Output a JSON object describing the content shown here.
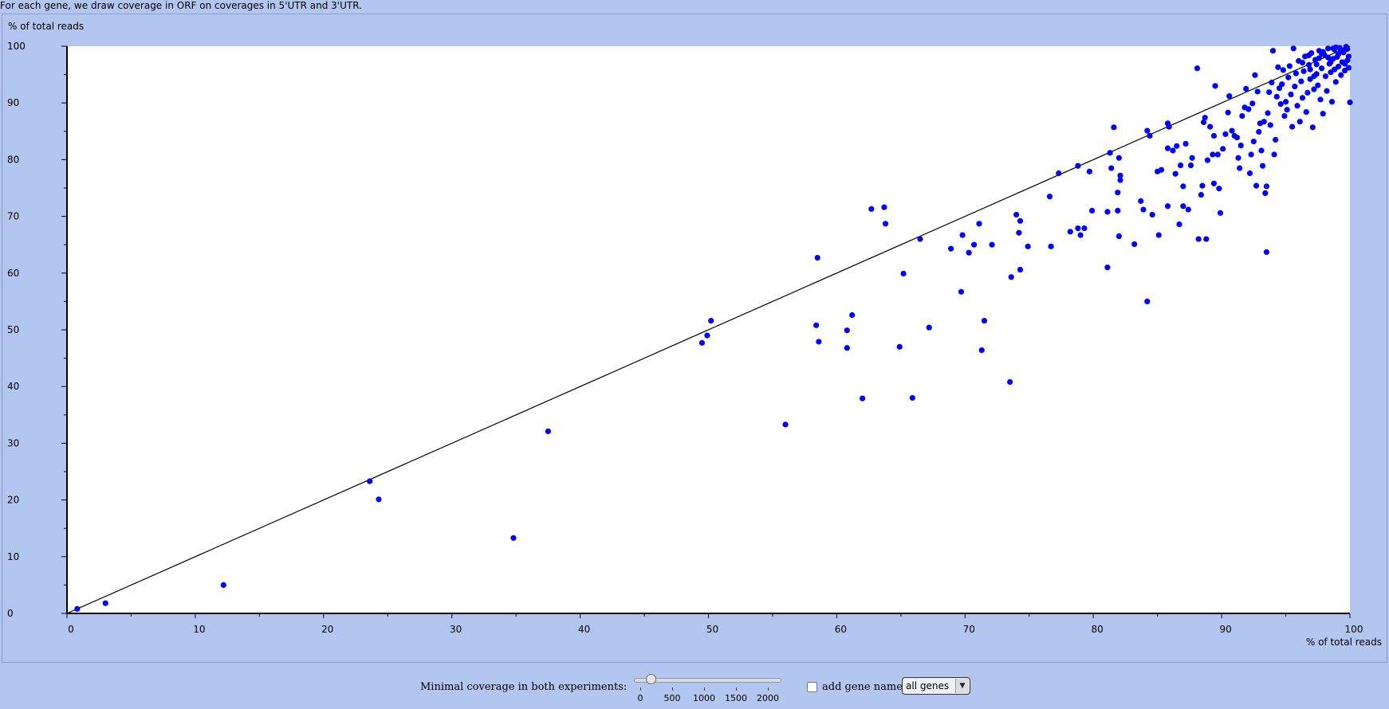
{
  "intro_text": "For each gene, we draw coverage in ORF on coverages in 5'UTR and 3'UTR.",
  "colors": {
    "panel_bg": "#b3c6ef",
    "plot_bg": "#ffffff",
    "point": "#0000ff",
    "line": "#000000"
  },
  "chart_data": {
    "type": "scatter",
    "ylabel": "% of total reads",
    "xlabel": "% of total reads",
    "xlim": [
      0,
      100
    ],
    "ylim": [
      0,
      100
    ],
    "x_ticks": [
      "0",
      "10",
      "20",
      "30",
      "40",
      "50",
      "60",
      "70",
      "80",
      "90",
      "100"
    ],
    "y_ticks": [
      "0",
      "10",
      "20",
      "30",
      "40",
      "50",
      "60",
      "70",
      "80",
      "90",
      "100"
    ],
    "reference_line": {
      "from": [
        0,
        0
      ],
      "to": [
        100,
        100
      ]
    },
    "points": [
      [
        0.8,
        0.8
      ],
      [
        3.0,
        1.8
      ],
      [
        12.2,
        5.0
      ],
      [
        23.6,
        23.3
      ],
      [
        24.3,
        20.1
      ],
      [
        34.8,
        13.3
      ],
      [
        37.5,
        32.1
      ],
      [
        49.5,
        47.7
      ],
      [
        49.9,
        49.0
      ],
      [
        50.2,
        51.6
      ],
      [
        56.0,
        33.3
      ],
      [
        58.5,
        62.7
      ],
      [
        58.4,
        50.8
      ],
      [
        58.6,
        47.9
      ],
      [
        60.8,
        49.9
      ],
      [
        61.2,
        52.6
      ],
      [
        60.8,
        46.8
      ],
      [
        62.7,
        71.3
      ],
      [
        62.0,
        37.9
      ],
      [
        63.7,
        71.6
      ],
      [
        63.8,
        68.7
      ],
      [
        64.9,
        47.0
      ],
      [
        65.2,
        59.9
      ],
      [
        65.9,
        38.0
      ],
      [
        66.5,
        66.0
      ],
      [
        67.2,
        50.4
      ],
      [
        68.9,
        64.3
      ],
      [
        69.7,
        56.7
      ],
      [
        69.8,
        66.7
      ],
      [
        70.3,
        63.6
      ],
      [
        70.7,
        65.0
      ],
      [
        71.1,
        68.7
      ],
      [
        71.3,
        46.4
      ],
      [
        71.5,
        51.6
      ],
      [
        72.1,
        65.0
      ],
      [
        73.5,
        40.8
      ],
      [
        73.6,
        59.3
      ],
      [
        74.0,
        70.3
      ],
      [
        74.3,
        69.2
      ],
      [
        74.2,
        67.1
      ],
      [
        74.3,
        60.6
      ],
      [
        74.9,
        64.7
      ],
      [
        76.6,
        73.5
      ],
      [
        76.7,
        64.7
      ],
      [
        77.3,
        77.6
      ],
      [
        78.2,
        67.3
      ],
      [
        78.8,
        67.9
      ],
      [
        78.8,
        78.9
      ],
      [
        79.0,
        66.7
      ],
      [
        79.3,
        67.9
      ],
      [
        79.7,
        77.9
      ],
      [
        79.9,
        71.0
      ],
      [
        81.1,
        61.0
      ],
      [
        81.1,
        70.8
      ],
      [
        81.3,
        81.2
      ],
      [
        81.4,
        78.5
      ],
      [
        81.6,
        85.7
      ],
      [
        81.9,
        71.0
      ],
      [
        81.9,
        74.2
      ],
      [
        82.0,
        80.3
      ],
      [
        82.0,
        66.5
      ],
      [
        82.1,
        77.2
      ],
      [
        82.1,
        76.4
      ],
      [
        83.2,
        65.1
      ],
      [
        83.7,
        72.7
      ],
      [
        83.9,
        71.2
      ],
      [
        84.2,
        85.1
      ],
      [
        84.2,
        55.0
      ],
      [
        84.4,
        84.2
      ],
      [
        84.6,
        70.3
      ],
      [
        85.0,
        77.9
      ],
      [
        85.1,
        66.7
      ],
      [
        85.3,
        78.2
      ],
      [
        85.8,
        71.8
      ],
      [
        85.8,
        86.4
      ],
      [
        85.9,
        85.8
      ],
      [
        85.8,
        82.0
      ],
      [
        86.2,
        81.6
      ],
      [
        86.4,
        77.5
      ],
      [
        86.5,
        82.4
      ],
      [
        86.7,
        68.6
      ],
      [
        86.8,
        79.0
      ],
      [
        87.0,
        75.3
      ],
      [
        87.0,
        71.8
      ],
      [
        87.2,
        82.8
      ],
      [
        87.4,
        71.2
      ],
      [
        87.6,
        79.0
      ],
      [
        87.7,
        80.3
      ],
      [
        88.1,
        96.1
      ],
      [
        88.2,
        66.0
      ],
      [
        88.4,
        73.8
      ],
      [
        88.5,
        75.4
      ],
      [
        88.6,
        86.6
      ],
      [
        88.7,
        87.4
      ],
      [
        88.8,
        66.0
      ],
      [
        88.9,
        79.9
      ],
      [
        89.1,
        85.8
      ],
      [
        89.3,
        80.9
      ],
      [
        89.4,
        84.2
      ],
      [
        89.4,
        75.8
      ],
      [
        89.5,
        93.0
      ],
      [
        89.7,
        80.9
      ],
      [
        89.8,
        74.9
      ],
      [
        89.9,
        70.6
      ],
      [
        90.1,
        81.9
      ],
      [
        90.3,
        84.5
      ],
      [
        90.5,
        88.3
      ],
      [
        90.6,
        91.2
      ],
      [
        90.8,
        85.1
      ],
      [
        91.0,
        84.2
      ],
      [
        91.2,
        83.9
      ],
      [
        91.3,
        80.3
      ],
      [
        91.4,
        78.5
      ],
      [
        91.5,
        82.5
      ],
      [
        91.6,
        87.7
      ],
      [
        91.8,
        89.2
      ],
      [
        91.9,
        92.5
      ],
      [
        92.1,
        88.9
      ],
      [
        92.2,
        77.6
      ],
      [
        92.3,
        80.9
      ],
      [
        92.4,
        89.9
      ],
      [
        92.5,
        83.2
      ],
      [
        92.6,
        94.9
      ],
      [
        92.7,
        75.4
      ],
      [
        92.8,
        92.0
      ],
      [
        92.9,
        84.9
      ],
      [
        93.0,
        86.4
      ],
      [
        93.1,
        81.6
      ],
      [
        93.2,
        78.9
      ],
      [
        93.3,
        86.7
      ],
      [
        93.4,
        74.1
      ],
      [
        93.5,
        63.7
      ],
      [
        93.5,
        75.3
      ],
      [
        93.6,
        88.2
      ],
      [
        93.7,
        91.9
      ],
      [
        93.8,
        86.1
      ],
      [
        93.9,
        93.6
      ],
      [
        94.0,
        99.2
      ],
      [
        94.1,
        80.9
      ],
      [
        94.2,
        83.5
      ],
      [
        94.3,
        91.1
      ],
      [
        94.4,
        96.3
      ],
      [
        94.5,
        92.6
      ],
      [
        94.6,
        89.8
      ],
      [
        94.7,
        93.3
      ],
      [
        94.8,
        95.8
      ],
      [
        94.9,
        87.7
      ],
      [
        95.0,
        90.2
      ],
      [
        95.1,
        88.8
      ],
      [
        95.2,
        94.5
      ],
      [
        95.3,
        96.5
      ],
      [
        95.4,
        91.5
      ],
      [
        95.5,
        85.8
      ],
      [
        95.6,
        99.6
      ],
      [
        95.7,
        92.9
      ],
      [
        95.8,
        95.2
      ],
      [
        95.9,
        89.5
      ],
      [
        96.0,
        97.4
      ],
      [
        96.1,
        86.7
      ],
      [
        96.2,
        93.8
      ],
      [
        96.3,
        90.9
      ],
      [
        96.4,
        95.6
      ],
      [
        96.5,
        98.2
      ],
      [
        96.6,
        88.4
      ],
      [
        96.7,
        91.8
      ],
      [
        96.8,
        96.7
      ],
      [
        96.9,
        94.2
      ],
      [
        97.0,
        98.8
      ],
      [
        97.1,
        85.7
      ],
      [
        97.2,
        92.4
      ],
      [
        97.3,
        97.6
      ],
      [
        97.4,
        95.1
      ],
      [
        97.5,
        93.1
      ],
      [
        97.6,
        99.2
      ],
      [
        97.7,
        90.6
      ],
      [
        97.8,
        96.1
      ],
      [
        97.9,
        88.1
      ],
      [
        98.0,
        98.5
      ],
      [
        98.1,
        94.7
      ],
      [
        98.2,
        92.1
      ],
      [
        98.3,
        99.6
      ],
      [
        98.4,
        96.9
      ],
      [
        98.5,
        95.4
      ],
      [
        98.6,
        90.2
      ],
      [
        98.7,
        97.8
      ],
      [
        98.8,
        99.4
      ],
      [
        98.9,
        93.7
      ],
      [
        99.0,
        98.1
      ],
      [
        99.1,
        96.4
      ],
      [
        99.2,
        99.7
      ],
      [
        99.3,
        94.9
      ],
      [
        99.4,
        97.2
      ],
      [
        99.5,
        98.9
      ],
      [
        99.6,
        95.7
      ],
      [
        99.7,
        99.9
      ],
      [
        99.8,
        97.5
      ],
      [
        99.9,
        96.2
      ],
      [
        100.0,
        90.1
      ],
      [
        99.5,
        99.3
      ],
      [
        98.9,
        99.8
      ],
      [
        98.5,
        97.2
      ],
      [
        97.9,
        99.0
      ],
      [
        97.4,
        96.8
      ],
      [
        96.8,
        98.4
      ],
      [
        96.3,
        97.1
      ],
      [
        99.8,
        99.5
      ],
      [
        99.1,
        98.6
      ],
      [
        98.3,
        98.0
      ],
      [
        97.6,
        97.9
      ],
      [
        99.6,
        96.9
      ],
      [
        98.8,
        95.9
      ],
      [
        97.2,
        94.7
      ],
      [
        99.9,
        98.2
      ],
      [
        99.3,
        99.1
      ],
      [
        98.7,
        99.6
      ],
      [
        97.8,
        98.7
      ],
      [
        96.9,
        95.9
      ]
    ]
  },
  "controls": {
    "min_coverage_label": "Minimal coverage in both experiments:",
    "slider_ticks": [
      "0",
      "500",
      "1000",
      "1500",
      "2000"
    ],
    "slider_value": 100,
    "slider_max": 2200,
    "checkbox_label": "add gene name",
    "checkbox_checked": false,
    "select_value": "all genes"
  }
}
